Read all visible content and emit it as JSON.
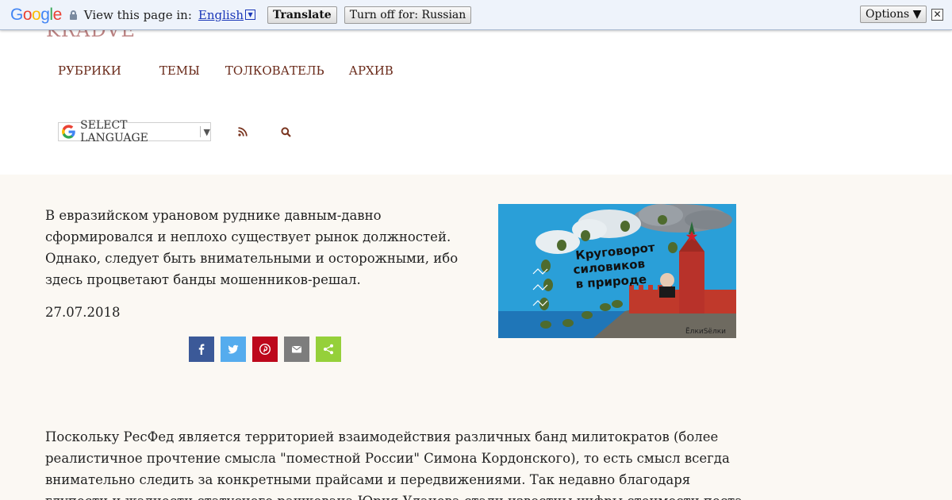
{
  "translate_bar": {
    "logo_letters": [
      "G",
      "o",
      "o",
      "g",
      "l",
      "e"
    ],
    "logo_colors": [
      "#4285f4",
      "#ea4335",
      "#fbbc05",
      "#4285f4",
      "#34a853",
      "#ea4335"
    ],
    "view_text": "View this page in:",
    "language": "English",
    "translate_label": "Translate",
    "turn_off_label": "Turn off for: Russian",
    "options_label": "Options ▼",
    "close_glyph": "✕"
  },
  "site": {
    "logo_fragment": "KRADVE",
    "nav": [
      {
        "label": "РУБРИКИ"
      },
      {
        "label": "ТЕМЫ"
      },
      {
        "label": "ТОЛКОВАТЕЛЬ"
      },
      {
        "label": "АРХИВ"
      }
    ],
    "language_select": {
      "label": "SELECT LANGUAGE",
      "arrow": "▼"
    },
    "icons": {
      "rss": "rss-icon",
      "search": "search-icon"
    },
    "accent_color": "#6a2a1a"
  },
  "article": {
    "lead": "В евразийском урановом руднике давным-давно сформировался и неплохо существует рынок должностей. Однако, следует быть внимательными и осторожными, ибо здесь процветают банды мошенников-решал.",
    "date": "27.07.2018",
    "share": [
      {
        "name": "facebook",
        "color": "#3b5998"
      },
      {
        "name": "twitter",
        "color": "#55acee"
      },
      {
        "name": "pinterest",
        "color": "#bd081c"
      },
      {
        "name": "email",
        "color": "#7d7d7d"
      },
      {
        "name": "sharethis",
        "color": "#95d03a"
      }
    ],
    "cartoon": {
      "caption_lines": [
        "Круговорот",
        "силовиков",
        "в природе"
      ],
      "signature": "ЁлкиSёлки"
    },
    "body": "Поскольку РесФед является территорией взаимодействия различных банд милитократов (более реалистичное прочтение смысла \"поместной России\" Симона Кордонского), то есть смысл всегда внимательно следить за конкретными прайсами и передвижениями. Так недавно благодаря глупости и жадности статусного рашкована Юрия Уланова стали известны цифры стоимости поста"
  }
}
